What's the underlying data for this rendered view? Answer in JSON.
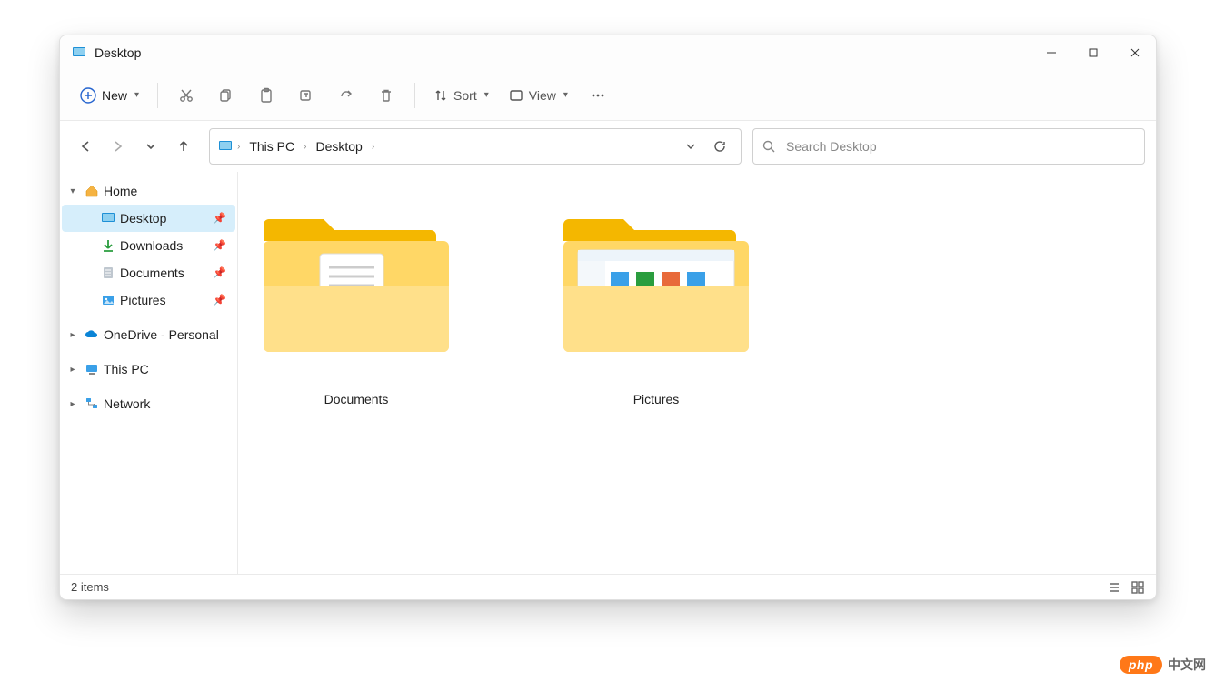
{
  "window": {
    "title": "Desktop"
  },
  "toolbar": {
    "new_label": "New",
    "sort_label": "Sort",
    "view_label": "View"
  },
  "breadcrumb": {
    "items": [
      {
        "label": "This PC"
      },
      {
        "label": "Desktop"
      }
    ]
  },
  "search": {
    "placeholder": "Search Desktop"
  },
  "sidebar": {
    "items": [
      {
        "label": "Home",
        "icon": "home-icon",
        "expanded": true,
        "level": 0
      },
      {
        "label": "Desktop",
        "icon": "desktop-icon",
        "pinned": true,
        "level": 1,
        "active": true
      },
      {
        "label": "Downloads",
        "icon": "downloads-icon",
        "pinned": true,
        "level": 1
      },
      {
        "label": "Documents",
        "icon": "documents-icon",
        "pinned": true,
        "level": 1
      },
      {
        "label": "Pictures",
        "icon": "pictures-icon",
        "pinned": true,
        "level": 1
      },
      {
        "label": "OneDrive - Personal",
        "icon": "onedrive-icon",
        "expandable": true,
        "level": 0
      },
      {
        "label": "This PC",
        "icon": "thispc-icon",
        "expandable": true,
        "level": 0
      },
      {
        "label": "Network",
        "icon": "network-icon",
        "expandable": true,
        "level": 0
      }
    ]
  },
  "content": {
    "folders": [
      {
        "name": "Documents",
        "preview": "document"
      },
      {
        "name": "Pictures",
        "preview": "explorer"
      }
    ]
  },
  "status": {
    "text": "2 items"
  },
  "watermark": {
    "brand": "php",
    "suffix": "中文网"
  }
}
